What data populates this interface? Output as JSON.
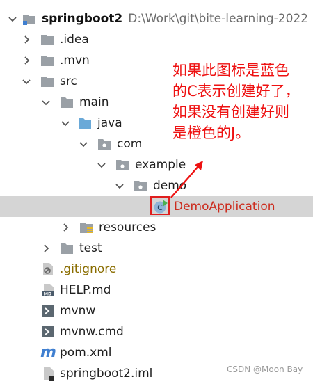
{
  "colors": {
    "folder": "#9aa0a6",
    "java_folder": "#6aa9d8",
    "resources_folder_stripe": "#e8b923",
    "selection": "#d5d5d5",
    "annotation_red": "#ee1111",
    "gitignore_text": "#8a6d00",
    "selected_text": "#cc2b1d"
  },
  "tree": {
    "root_name": "springboot2",
    "root_path": "D:\\Work\\git\\bite-learning-2022",
    "idea": ".idea",
    "mvn": ".mvn",
    "src": "src",
    "main": "main",
    "java": "java",
    "com": "com",
    "example": "example",
    "demo": "demo",
    "demo_application": "DemoApplication",
    "resources": "resources",
    "test": "test",
    "gitignore": ".gitignore",
    "help": "HELP.md",
    "mvnw": "mvnw",
    "mvnw_cmd": "mvnw.cmd",
    "pom": "pom.xml",
    "iml": "springboot2.iml"
  },
  "annotation": {
    "line1": "如果此图标是蓝色",
    "line2": "的C表示创建好了，",
    "line3": "如果没有创建好则",
    "line4": "是橙色的J。"
  },
  "icons": {
    "class_icon_letter": "C",
    "md_badge": "MD",
    "pom_letter": "m"
  },
  "watermark": "CSDN @Moon Bay"
}
